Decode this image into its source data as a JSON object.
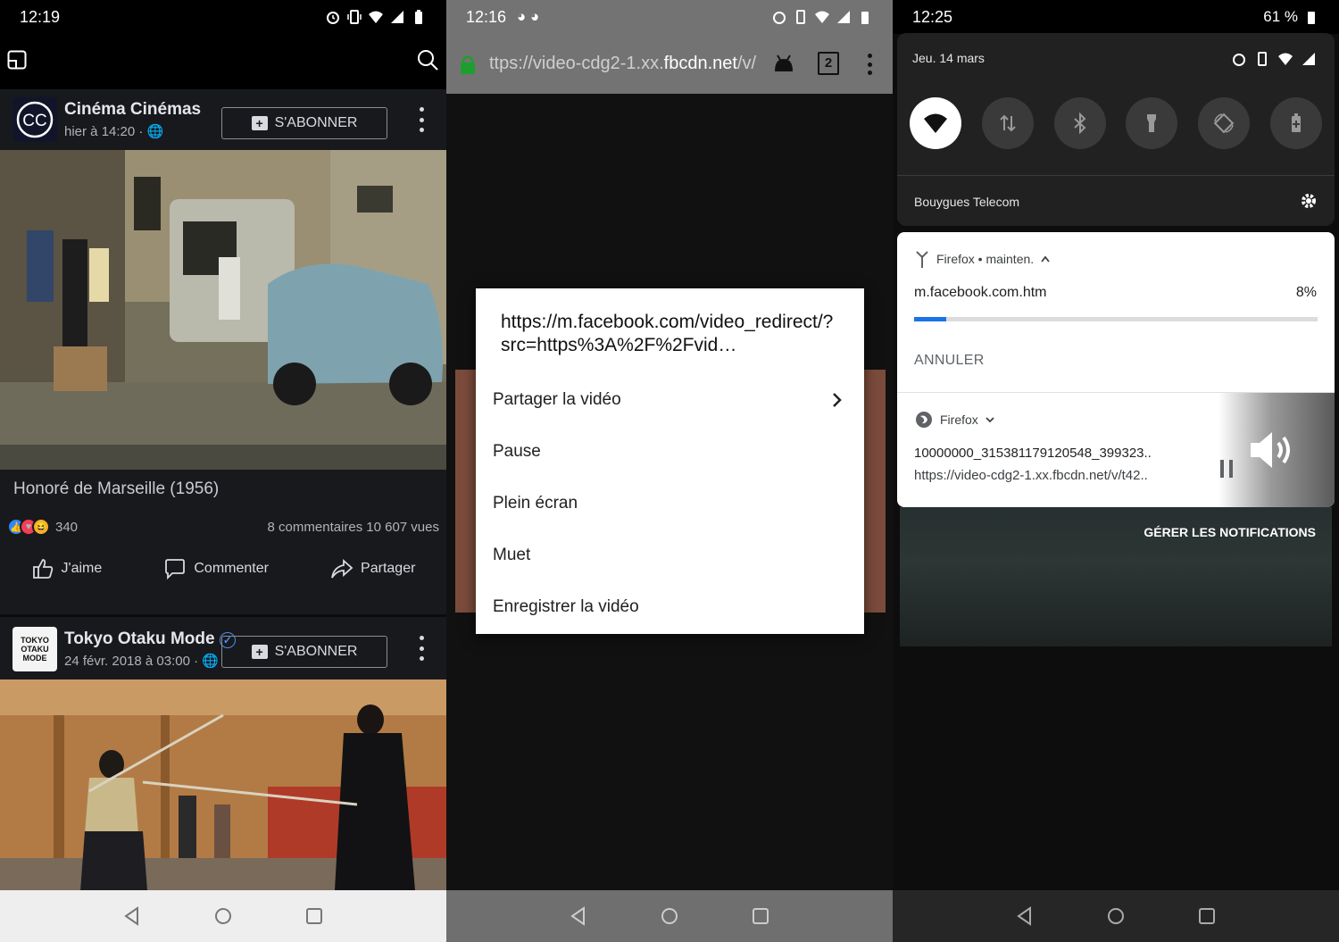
{
  "panel1": {
    "status": {
      "time": "12:19"
    },
    "post1": {
      "page_name": "Cinéma Cinémas",
      "avatar_text": "CC",
      "timestamp": "hier à 14:20 · ",
      "subscribe_label": "S'ABONNER",
      "video_title": "Honoré de Marseille (1956)",
      "reactions_count": "340",
      "comments": "8 commentaires",
      "views": "10 607 vues",
      "like_label": "J'aime",
      "comment_label": "Commenter",
      "share_label": "Partager"
    },
    "post2": {
      "page_name": "Tokyo Otaku Mode",
      "timestamp": "24 févr. 2018 à 03:00 · ",
      "subscribe_label": "S'ABONNER",
      "avatar_text": "TOKYO OTAKU MODE"
    }
  },
  "panel2": {
    "status": {
      "time": "12:16"
    },
    "url_prefix": "ttps://video-cdg2-1.xx.",
    "url_domain": "fbcdn.net",
    "url_suffix": "/v/",
    "tab_count": "2",
    "menu": {
      "url": "https://m.facebook.com/video_redirect/?src=https%3A%2F%2Fvid…",
      "items": [
        {
          "label": "Partager la vidéo",
          "has_submenu": true
        },
        {
          "label": "Pause"
        },
        {
          "label": "Plein écran"
        },
        {
          "label": "Muet"
        },
        {
          "label": "Enregistrer la vidéo"
        }
      ]
    }
  },
  "panel3": {
    "status": {
      "time": "12:25",
      "battery": "61 %"
    },
    "quick_settings": {
      "date": "Jeu. 14 mars",
      "carrier": "Bouygues Telecom",
      "tiles": [
        "wifi-icon",
        "data-transfer-icon",
        "bluetooth-icon",
        "flashlight-icon",
        "auto-rotate-icon",
        "battery-saver-icon"
      ]
    },
    "download_notification": {
      "app": "Firefox • mainten. ",
      "filename": "m.facebook.com.htm",
      "progress_percent": 8,
      "progress_text": "8%",
      "cancel_label": "ANNULER"
    },
    "media_notification": {
      "app": "Firefox",
      "title": "10000000_315381179120548_399323..",
      "url": "https://video-cdg2-1.xx.fbcdn.net/v/t42.."
    },
    "manage_label": "GÉRER LES NOTIFICATIONS"
  },
  "colors": {
    "fb_dark": "#18191d",
    "progress": "#1a73e8",
    "toolbar_grey": "#737373",
    "lock_green": "#1e9e2e"
  }
}
